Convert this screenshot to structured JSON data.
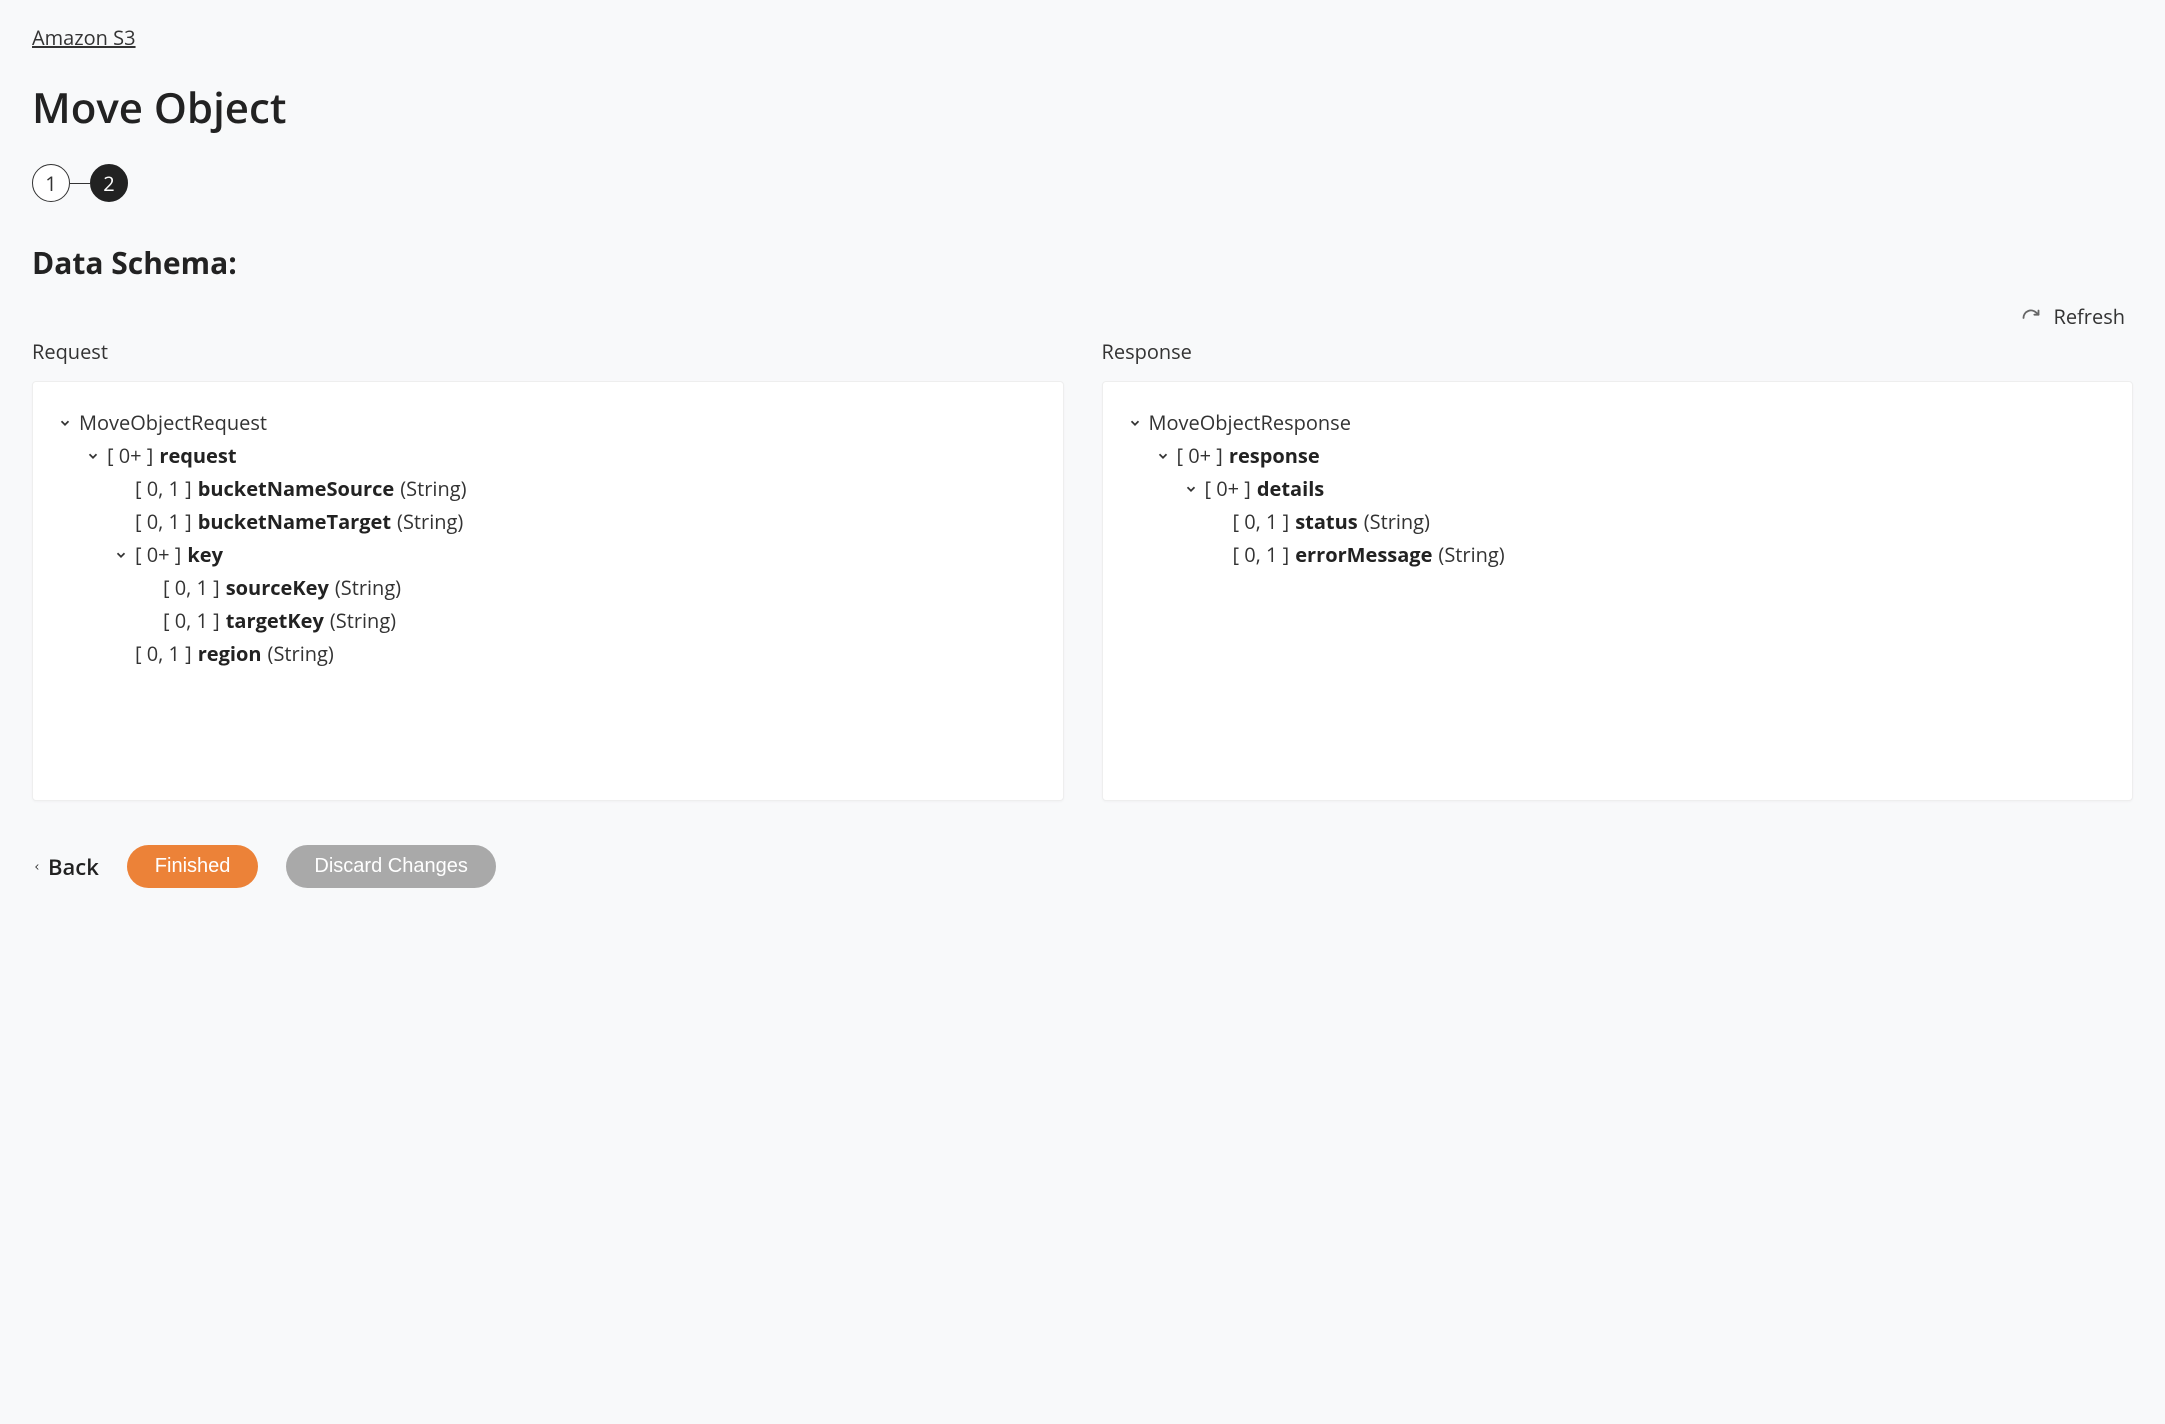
{
  "breadcrumb": {
    "label": "Amazon S3"
  },
  "title": "Move Object",
  "stepper": {
    "steps": [
      "1",
      "2"
    ],
    "activeIndex": 1
  },
  "sectionTitle": "Data Schema:",
  "refresh": {
    "label": "Refresh"
  },
  "columns": {
    "request": {
      "label": "Request"
    },
    "response": {
      "label": "Response"
    }
  },
  "requestTree": {
    "root": "MoveObjectRequest",
    "request": {
      "card": "[ 0+ ]",
      "name": "request",
      "bucketNameSource": {
        "card": "[ 0, 1 ]",
        "name": "bucketNameSource",
        "type": "(String)"
      },
      "bucketNameTarget": {
        "card": "[ 0, 1 ]",
        "name": "bucketNameTarget",
        "type": "(String)"
      },
      "key": {
        "card": "[ 0+ ]",
        "name": "key",
        "sourceKey": {
          "card": "[ 0, 1 ]",
          "name": "sourceKey",
          "type": "(String)"
        },
        "targetKey": {
          "card": "[ 0, 1 ]",
          "name": "targetKey",
          "type": "(String)"
        }
      },
      "region": {
        "card": "[ 0, 1 ]",
        "name": "region",
        "type": "(String)"
      }
    }
  },
  "responseTree": {
    "root": "MoveObjectResponse",
    "response": {
      "card": "[ 0+ ]",
      "name": "response",
      "details": {
        "card": "[ 0+ ]",
        "name": "details",
        "status": {
          "card": "[ 0, 1 ]",
          "name": "status",
          "type": "(String)"
        },
        "errorMessage": {
          "card": "[ 0, 1 ]",
          "name": "errorMessage",
          "type": "(String)"
        }
      }
    }
  },
  "footer": {
    "back": "Back",
    "finished": "Finished",
    "discard": "Discard Changes"
  }
}
